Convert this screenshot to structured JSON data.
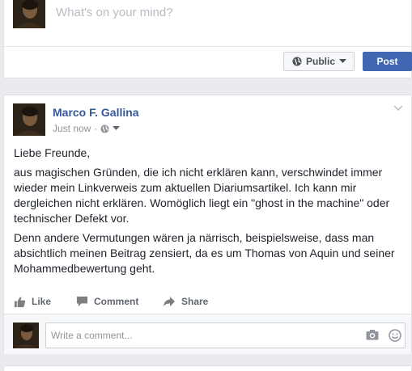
{
  "composer": {
    "placeholder": "What's on your mind?",
    "privacy_label": "Public",
    "post_label": "Post"
  },
  "post": {
    "author": "Marco F. Gallina",
    "timestamp": "Just now",
    "paragraphs": [
      "Liebe Freunde,",
      "aus magischen Gründen, die ich nicht erklären kann, verschwindet immer wieder mein Linkverweis zum aktuellen Diariumsartikel. Ich kann mir dergleichen nicht erklären. Womöglich liegt ein \"ghost in the machine\" oder technischer Defekt vor.",
      "Denn andere Vermutungen wären ja närrisch, beispielsweise, dass man absichtlich meinen Beitrag zensiert, da es um Thomas von Aquin und seiner Mohammedbewertung geht."
    ],
    "actions": {
      "like": "Like",
      "comment": "Comment",
      "share": "Share"
    },
    "comment_placeholder": "Write a comment..."
  },
  "colors": {
    "brand": "#4267b2",
    "link": "#365899",
    "muted": "#90949c",
    "background": "#e9ebee"
  },
  "icons": [
    "globe-icon",
    "chevron-down-icon",
    "thumbs-up-icon",
    "comment-icon",
    "share-arrow-icon",
    "camera-icon",
    "smiley-icon"
  ]
}
